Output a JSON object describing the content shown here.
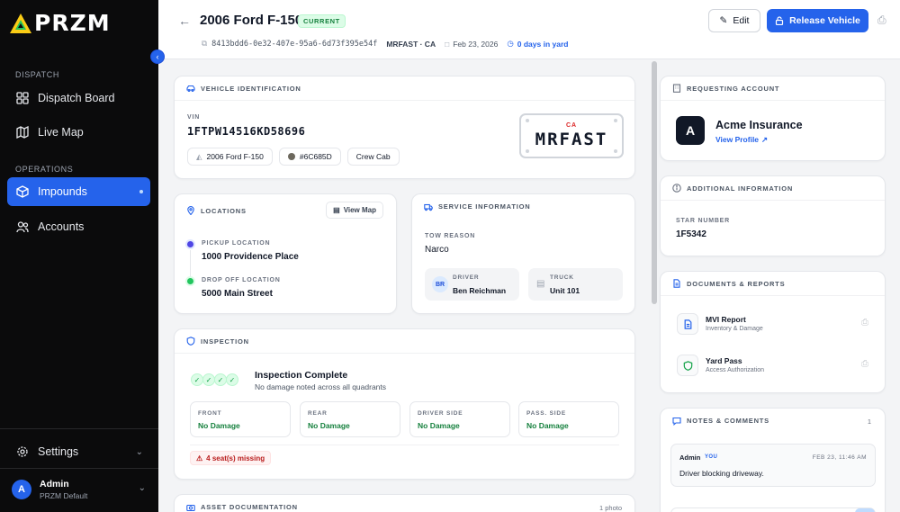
{
  "app": {
    "logo_text": "PRZM"
  },
  "sidebar": {
    "sections": {
      "dispatch": "DISPATCH",
      "operations": "OPERATIONS"
    },
    "items": [
      {
        "label": "Dispatch Board",
        "icon": "grid-icon"
      },
      {
        "label": "Live Map",
        "icon": "map-icon"
      },
      {
        "label": "Impounds",
        "icon": "cube-icon",
        "active": true
      },
      {
        "label": "Accounts",
        "icon": "users-icon"
      }
    ],
    "settings_label": "Settings",
    "user": {
      "initial": "A",
      "name": "Admin",
      "org": "PRZM Default"
    }
  },
  "header": {
    "title": "2006 Ford F-150",
    "status_badge": "CURRENT",
    "id": "8413bdd6-0e32-407e-95a6-6d73f395e54f",
    "plate_state": "MRFAST · CA",
    "date": "Feb 23, 2026",
    "days_in_yard": "0 days in yard",
    "edit_label": "Edit",
    "release_label": "Release Vehicle"
  },
  "vehicle": {
    "section_title": "VEHICLE IDENTIFICATION",
    "vin_label": "VIN",
    "vin": "1FTPW14516KD58696",
    "chips": {
      "model": "2006 Ford F-150",
      "color": "#6C685D",
      "cab": "Crew Cab"
    },
    "plate": {
      "state": "CA",
      "number": "MRFAST"
    }
  },
  "locations": {
    "section_title": "LOCATIONS",
    "view_map_label": "View Map",
    "pickup_label": "PICKUP LOCATION",
    "pickup": "1000 Providence Place",
    "dropoff_label": "DROP OFF LOCATION",
    "dropoff": "5000 Main Street"
  },
  "service": {
    "section_title": "SERVICE INFORMATION",
    "tow_reason_label": "TOW REASON",
    "tow_reason": "Narco",
    "driver_label": "DRIVER",
    "driver_initials": "BR",
    "driver": "Ben Reichman",
    "truck_label": "TRUCK",
    "truck": "Unit 101"
  },
  "inspection": {
    "section_title": "INSPECTION",
    "status": "Inspection Complete",
    "note": "No damage noted across all quadrants",
    "quadrants": [
      {
        "label": "FRONT",
        "value": "No Damage"
      },
      {
        "label": "REAR",
        "value": "No Damage"
      },
      {
        "label": "DRIVER SIDE",
        "value": "No Damage"
      },
      {
        "label": "PASS. SIDE",
        "value": "No Damage"
      }
    ],
    "warning": "4 seat(s) missing"
  },
  "asset_docs": {
    "section_title": "ASSET DOCUMENTATION",
    "count": "1 photo"
  },
  "account": {
    "section_title": "REQUESTING ACCOUNT",
    "initial": "A",
    "name": "Acme Insurance",
    "view_profile": "View Profile"
  },
  "additional": {
    "section_title": "ADDITIONAL INFORMATION",
    "star_label": "STAR NUMBER",
    "star_number": "1F5342"
  },
  "documents": {
    "section_title": "DOCUMENTS & REPORTS",
    "items": [
      {
        "title": "MVI Report",
        "subtitle": "Inventory & Damage"
      },
      {
        "title": "Yard Pass",
        "subtitle": "Access Authorization"
      }
    ]
  },
  "notes": {
    "section_title": "NOTES & COMMENTS",
    "count": "1",
    "items": [
      {
        "author": "Admin",
        "tag": "YOU",
        "timestamp": "FEB 23, 11:46 AM",
        "text": "Driver blocking driveway."
      }
    ]
  },
  "colors": {
    "accent": "#2563eb",
    "success": "#15803d",
    "danger": "#dc2626",
    "sidebar_bg": "#0b0b0c",
    "vehicle_color": "#6C685D"
  }
}
